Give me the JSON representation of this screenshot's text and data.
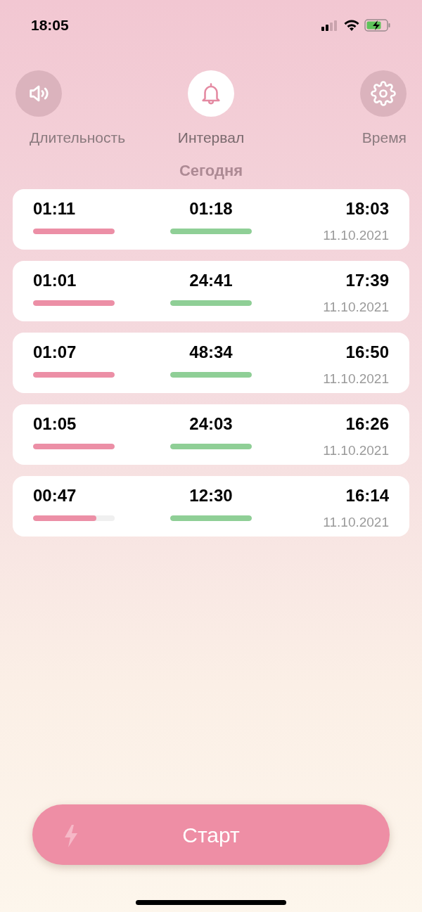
{
  "status_bar": {
    "time": "18:05"
  },
  "tabs": [
    {
      "label": "Длительность",
      "kind": "sound",
      "selected": false
    },
    {
      "label": "Интервал",
      "kind": "bell",
      "selected": true
    },
    {
      "label": "Время",
      "kind": "gear",
      "selected": false
    }
  ],
  "section_title": "Сегодня",
  "records": [
    {
      "duration": {
        "value": "01:11",
        "level": 1
      },
      "interval": {
        "value": "01:18",
        "level": 1
      },
      "time": "18:03",
      "date": "11.10.2021"
    },
    {
      "duration": {
        "value": "01:01",
        "level": 1
      },
      "interval": {
        "value": "24:41",
        "level": 1
      },
      "time": "17:39",
      "date": "11.10.2021"
    },
    {
      "duration": {
        "value": "01:07",
        "level": 1
      },
      "interval": {
        "value": "48:34",
        "level": 1
      },
      "time": "16:50",
      "date": "11.10.2021"
    },
    {
      "duration": {
        "value": "01:05",
        "level": 1
      },
      "interval": {
        "value": "24:03",
        "level": 1
      },
      "time": "16:26",
      "date": "11.10.2021"
    },
    {
      "duration": {
        "value": "00:47",
        "level": 0.78
      },
      "interval": {
        "value": "12:30",
        "level": 1
      },
      "time": "16:14",
      "date": "11.10.2021"
    }
  ],
  "start_button": {
    "label": "Старт"
  }
}
